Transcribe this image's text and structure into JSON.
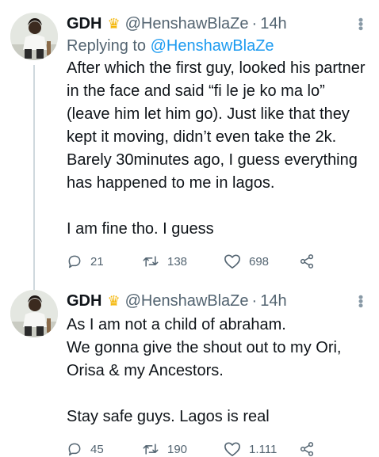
{
  "tweets": [
    {
      "name": "GDH",
      "badge_icon": "crown-emoji",
      "handle": "@HenshawBlaZe",
      "separator": "·",
      "time": "14h",
      "replying_prefix": "Replying to",
      "replying_handle": "@HenshawBlaZe",
      "text": "After which the first guy, looked his partner in the face and said “fi le je ko ma lo” (leave him let him go). Just like that they kept it moving, didn’t even take the 2k. Barely 30minutes ago, I guess everything has happened to me in lagos.\n\nI am fine tho. I guess",
      "replies": "21",
      "retweets": "138",
      "likes": "698"
    },
    {
      "name": "GDH",
      "badge_icon": "crown-emoji",
      "handle": "@HenshawBlaZe",
      "separator": "·",
      "time": "14h",
      "text": "As I am not a child of abraham.\nWe gonna give the shout out to my Ori, Orisa & my Ancestors.\n\nStay safe guys. Lagos is real",
      "replies": "45",
      "retweets": "190",
      "likes": "1.111"
    }
  ],
  "colors": {
    "link": "#1d9bf0",
    "muted": "#536471",
    "thread_line": "#cfd9de"
  }
}
